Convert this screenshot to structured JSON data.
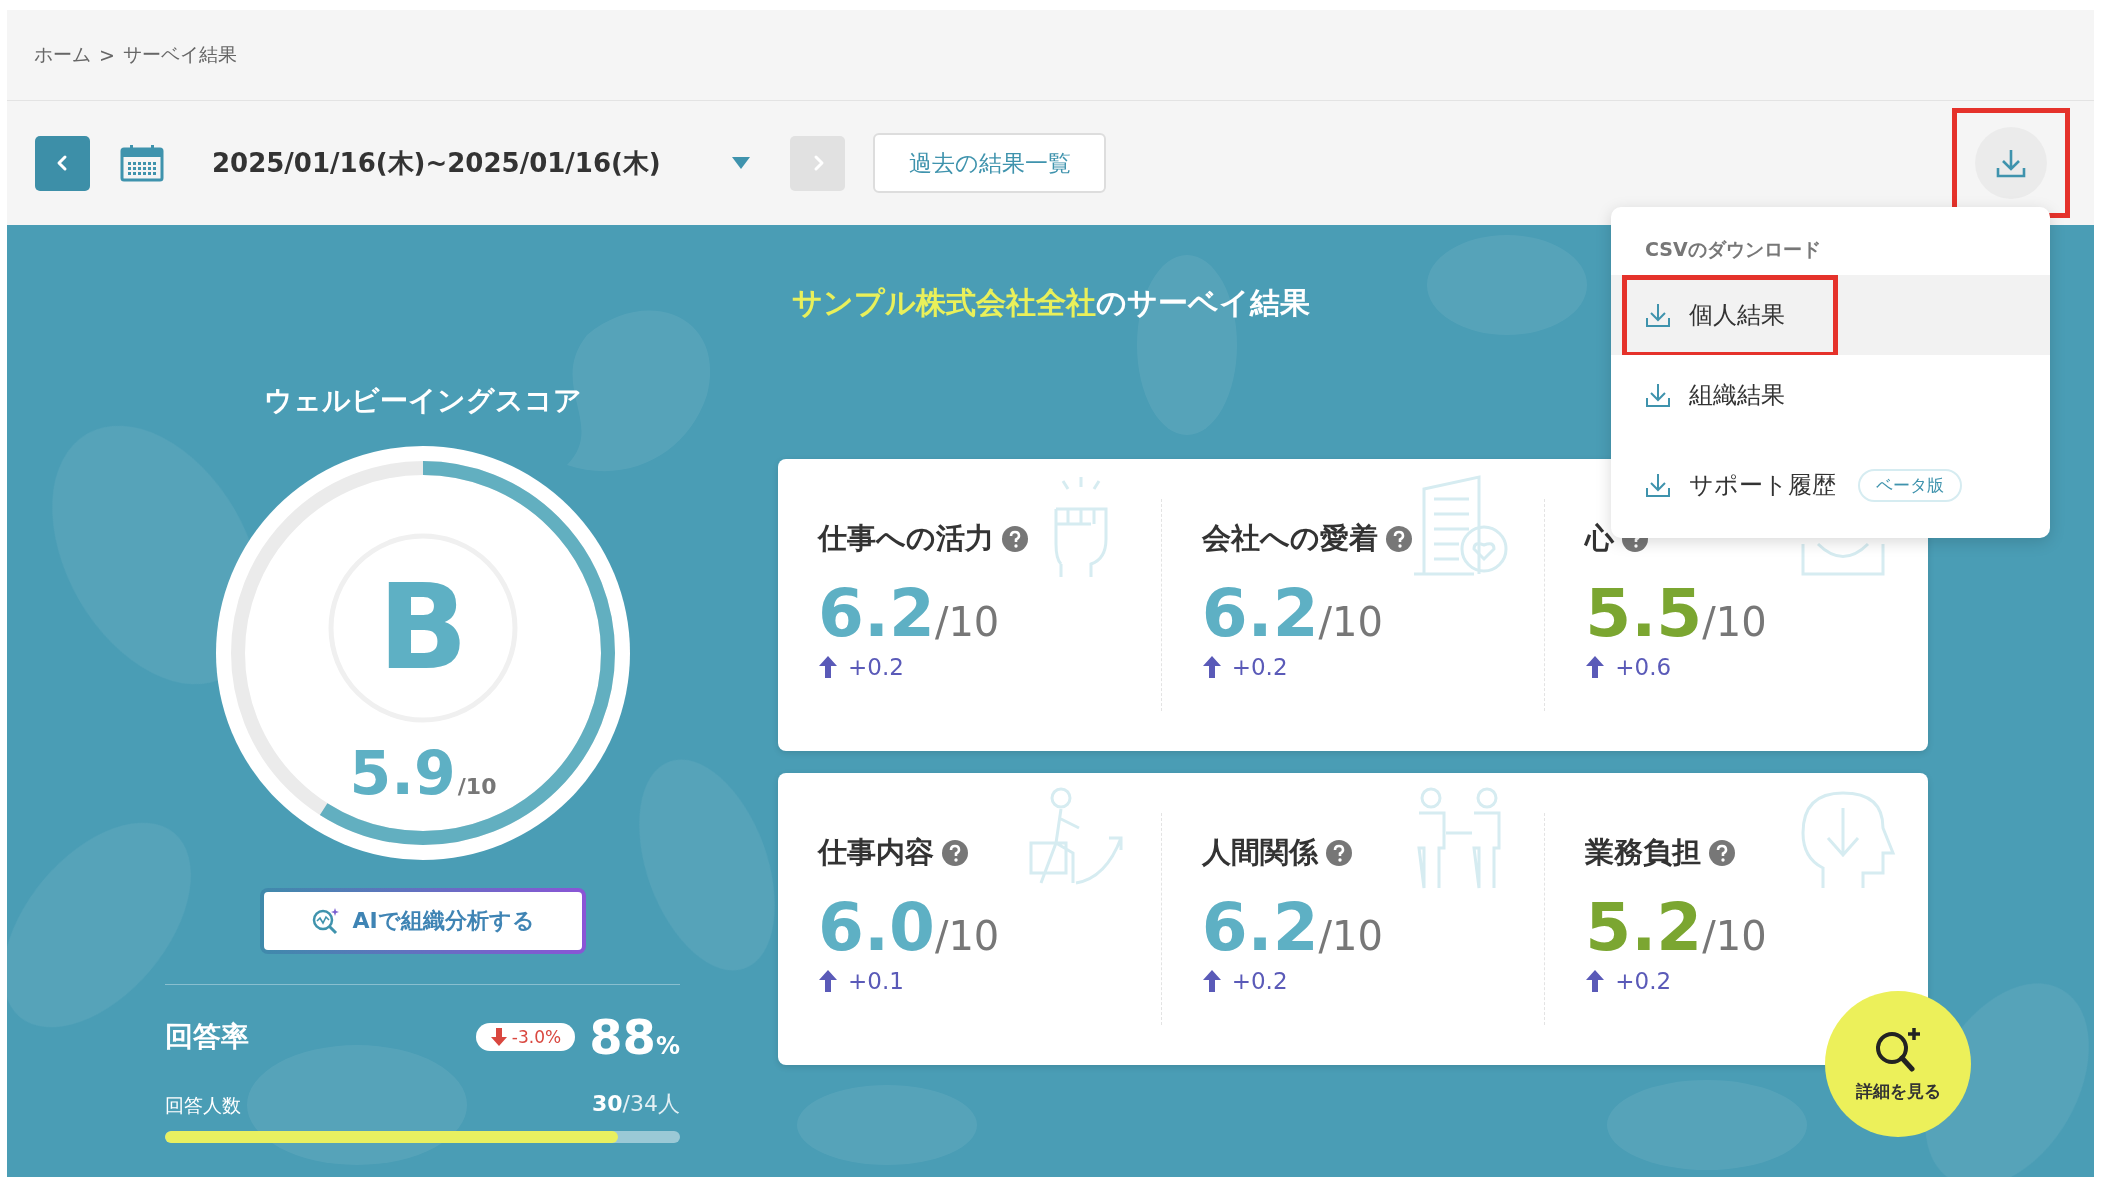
{
  "breadcrumb": {
    "items": [
      {
        "label": "ホーム"
      },
      {
        "label": "サーベイ結果"
      }
    ],
    "separator": ">"
  },
  "toolbar": {
    "prev_disabled": false,
    "date_range": "2025/01/16(木)~2025/01/16(木)",
    "next_disabled": true,
    "history_button": "過去の結果一覧",
    "download_highlighted": true
  },
  "download_menu": {
    "heading": "CSVのダウンロード",
    "items": [
      {
        "label": "個人結果",
        "selected": true,
        "highlighted": true
      },
      {
        "label": "組織結果",
        "selected": false,
        "highlighted": false
      },
      {
        "label": "サポート履歴",
        "selected": false,
        "highlighted": false,
        "badge": "ベータ版"
      }
    ]
  },
  "title": {
    "company": "サンプル株式会社全社",
    "suffix": "のサーベイ結果"
  },
  "score": {
    "heading": "ウェルビーイングスコア",
    "grade": "B",
    "value": "5.9",
    "max": "/10",
    "level": 0.59
  },
  "ai_button": "AIで組織分析する",
  "response": {
    "label": "回答率",
    "change": {
      "kind": "down",
      "text": "-3.0%"
    },
    "value": "88",
    "unit": "%",
    "count_label": "回答人数",
    "count": "30",
    "total": "/34人",
    "level": 0.88
  },
  "card_rows": [
    {
      "metrics": [
        {
          "kind": "fist",
          "title": "仕事への活力",
          "value": "6.2",
          "color": "#5eb0c4",
          "max": "/10",
          "change": {
            "kind": "up",
            "text": "+0.2"
          }
        },
        {
          "kind": "building",
          "title": "会社への愛着",
          "value": "6.2",
          "color": "#5eb0c4",
          "max": "/10",
          "change": {
            "kind": "up",
            "text": "+0.2"
          }
        },
        {
          "kind": "body",
          "title": "心",
          "value": "5.5",
          "color": "#7ba631",
          "max": "/10",
          "change": {
            "kind": "up",
            "text": "+0.6"
          }
        }
      ]
    },
    {
      "metrics": [
        {
          "kind": "stairs",
          "title": "仕事内容",
          "value": "6.0",
          "color": "#5eb0c4",
          "max": "/10",
          "change": {
            "kind": "up",
            "text": "+0.1"
          }
        },
        {
          "kind": "people",
          "title": "人間関係",
          "value": "6.2",
          "color": "#5eb0c4",
          "max": "/10",
          "change": {
            "kind": "up",
            "text": "+0.2"
          }
        },
        {
          "kind": "head",
          "title": "業務負担",
          "value": "5.2",
          "color": "#7ba631",
          "max": "/10",
          "change": {
            "kind": "up",
            "text": "+0.2"
          }
        }
      ]
    }
  ],
  "detail_button": "詳細を見る"
}
